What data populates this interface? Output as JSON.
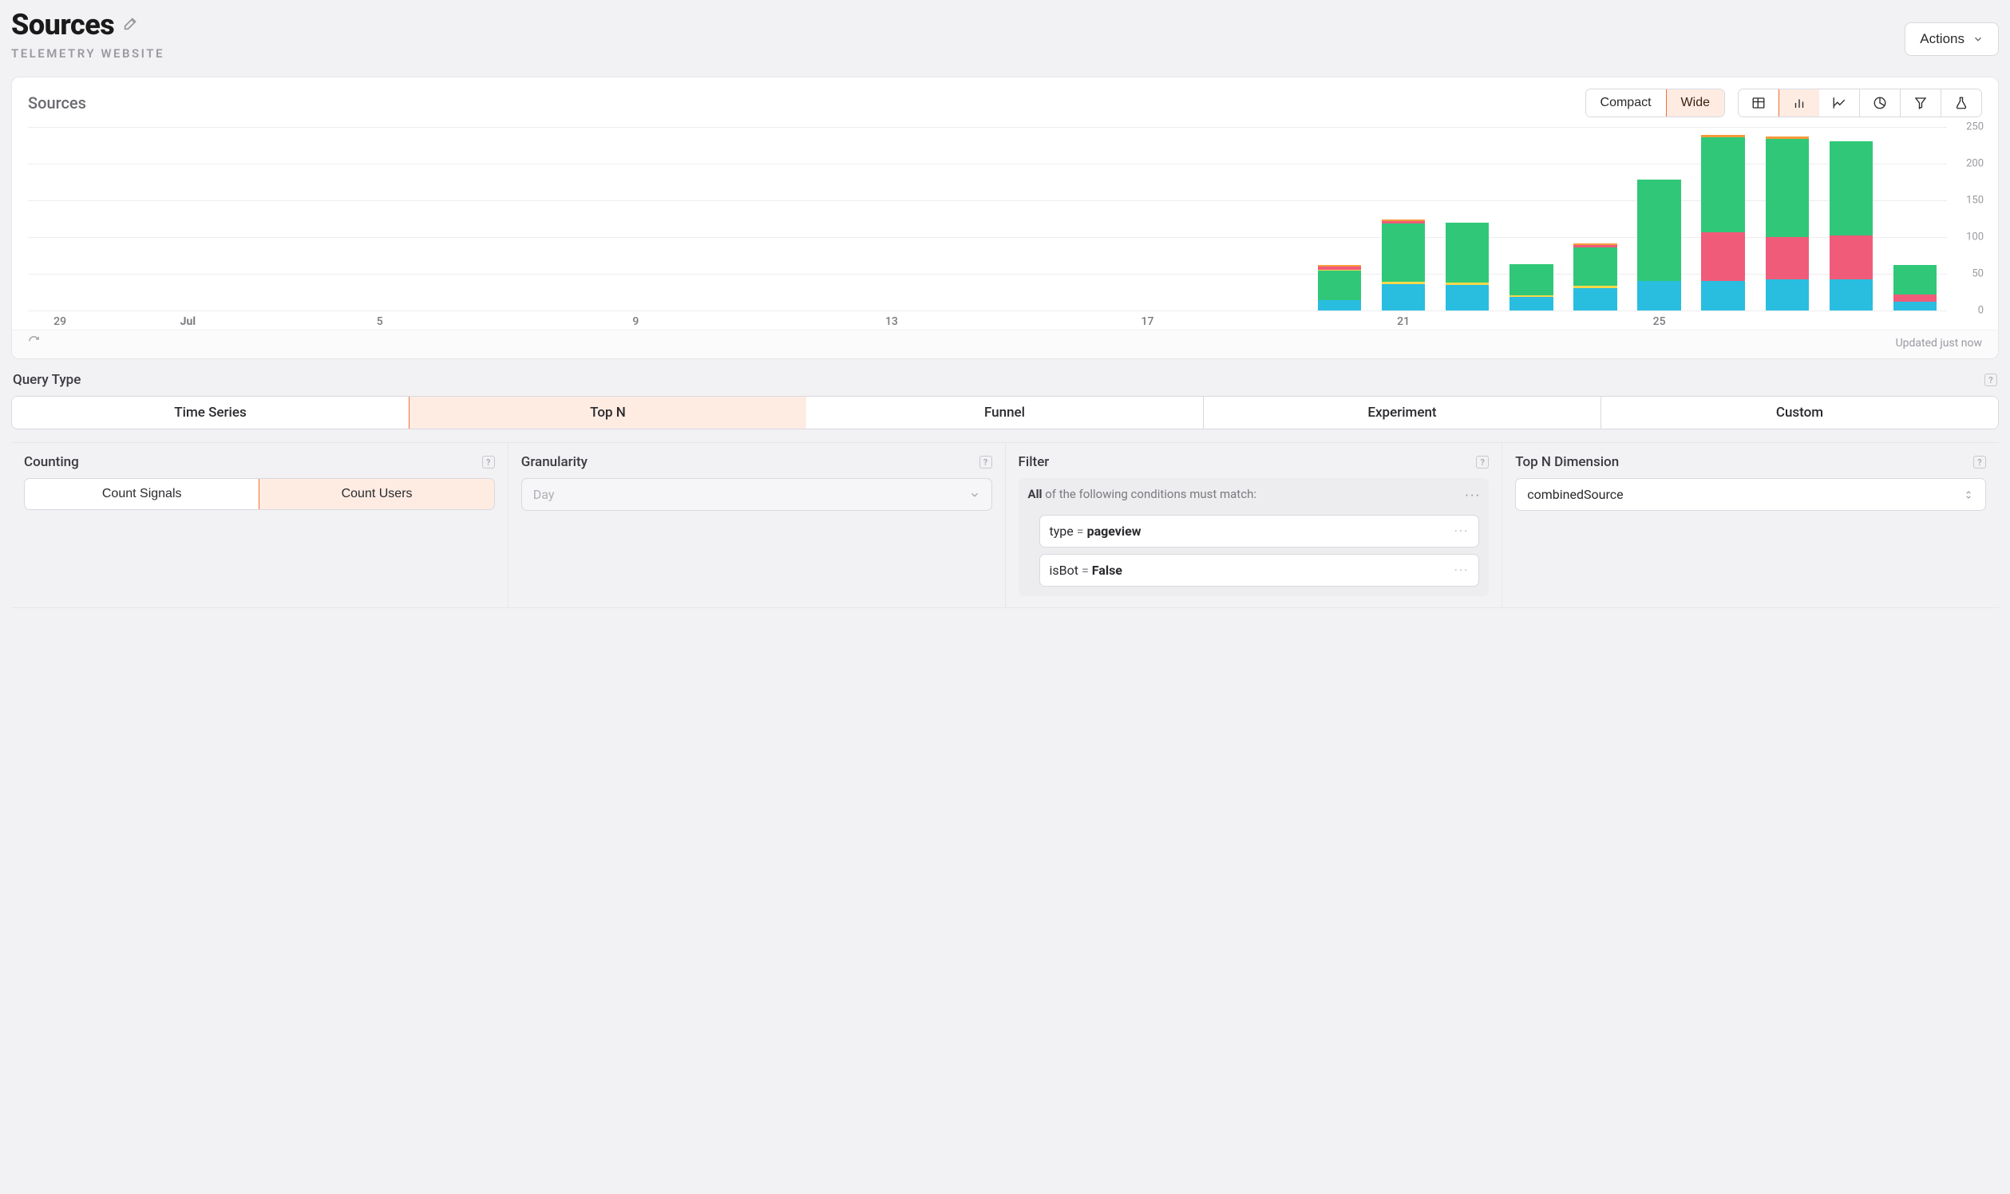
{
  "header": {
    "title": "Sources",
    "subtitle": "TELEMETRY WEBSITE",
    "actions_label": "Actions"
  },
  "chart_card": {
    "title": "Sources",
    "view_toggle": {
      "compact": "Compact",
      "wide": "Wide",
      "active": "wide"
    },
    "icon_tabs": [
      "table",
      "bar",
      "line",
      "pie",
      "funnel",
      "flask"
    ],
    "icon_tabs_active": "bar",
    "updated_text": "Updated just now"
  },
  "chart_data": {
    "type": "bar",
    "stacked": true,
    "ylabel": "",
    "xlabel": "",
    "ylim": [
      0,
      250
    ],
    "yticks": [
      0,
      50,
      100,
      150,
      200,
      250
    ],
    "categories": [
      "29",
      "",
      "Jul",
      "",
      "",
      "5",
      "",
      "",
      "",
      "9",
      "",
      "",
      "",
      "13",
      "",
      "",
      "",
      "17",
      "",
      "",
      "",
      "21",
      "",
      "",
      "",
      "25",
      "",
      "",
      ""
    ],
    "x_tick_labels": {
      "0": "29",
      "2": "Jul",
      "5": "5",
      "9": "9",
      "13": "13",
      "17": "17",
      "21": "21",
      "25": "25"
    },
    "series_colors": {
      "blue": "#29bde0",
      "green": "#30c878",
      "pink": "#f05b7a",
      "orange": "#f59b3a",
      "yellow": "#f8d84a"
    },
    "bars": [
      {
        "i": 0,
        "segments": []
      },
      {
        "i": 1,
        "segments": []
      },
      {
        "i": 2,
        "segments": []
      },
      {
        "i": 3,
        "segments": []
      },
      {
        "i": 4,
        "segments": []
      },
      {
        "i": 5,
        "segments": []
      },
      {
        "i": 6,
        "segments": []
      },
      {
        "i": 7,
        "segments": []
      },
      {
        "i": 8,
        "segments": []
      },
      {
        "i": 9,
        "segments": []
      },
      {
        "i": 10,
        "segments": []
      },
      {
        "i": 11,
        "segments": []
      },
      {
        "i": 12,
        "segments": []
      },
      {
        "i": 13,
        "segments": []
      },
      {
        "i": 14,
        "segments": []
      },
      {
        "i": 15,
        "segments": []
      },
      {
        "i": 16,
        "segments": []
      },
      {
        "i": 17,
        "segments": []
      },
      {
        "i": 18,
        "segments": []
      },
      {
        "i": 19,
        "segments": []
      },
      {
        "i": 20,
        "segments": [
          {
            "c": "blue",
            "v": 14
          },
          {
            "c": "green",
            "v": 40
          },
          {
            "c": "yellow",
            "v": 2
          },
          {
            "c": "pink",
            "v": 4
          },
          {
            "c": "orange",
            "v": 2
          }
        ]
      },
      {
        "i": 21,
        "segments": [
          {
            "c": "blue",
            "v": 36
          },
          {
            "c": "yellow",
            "v": 3
          },
          {
            "c": "green",
            "v": 80
          },
          {
            "c": "pink",
            "v": 3
          },
          {
            "c": "orange",
            "v": 2
          }
        ]
      },
      {
        "i": 22,
        "segments": [
          {
            "c": "blue",
            "v": 35
          },
          {
            "c": "yellow",
            "v": 3
          },
          {
            "c": "green",
            "v": 82
          }
        ]
      },
      {
        "i": 23,
        "segments": [
          {
            "c": "blue",
            "v": 18
          },
          {
            "c": "yellow",
            "v": 3
          },
          {
            "c": "green",
            "v": 42
          }
        ]
      },
      {
        "i": 24,
        "segments": [
          {
            "c": "blue",
            "v": 30
          },
          {
            "c": "yellow",
            "v": 4
          },
          {
            "c": "green",
            "v": 52
          },
          {
            "c": "pink",
            "v": 3
          },
          {
            "c": "orange",
            "v": 2
          }
        ]
      },
      {
        "i": 25,
        "segments": [
          {
            "c": "blue",
            "v": 40
          },
          {
            "c": "green",
            "v": 138
          }
        ]
      },
      {
        "i": 26,
        "segments": [
          {
            "c": "blue",
            "v": 40
          },
          {
            "c": "pink",
            "v": 66
          },
          {
            "c": "green",
            "v": 130
          },
          {
            "c": "orange",
            "v": 3
          }
        ]
      },
      {
        "i": 27,
        "segments": [
          {
            "c": "blue",
            "v": 42
          },
          {
            "c": "pink",
            "v": 58
          },
          {
            "c": "green",
            "v": 134
          },
          {
            "c": "orange",
            "v": 3
          }
        ]
      },
      {
        "i": 28,
        "segments": [
          {
            "c": "blue",
            "v": 42
          },
          {
            "c": "pink",
            "v": 60
          },
          {
            "c": "green",
            "v": 128
          }
        ]
      },
      {
        "i": 29,
        "segments": [
          {
            "c": "blue",
            "v": 12
          },
          {
            "c": "pink",
            "v": 10
          },
          {
            "c": "green",
            "v": 40
          }
        ]
      }
    ]
  },
  "query_type": {
    "label": "Query Type",
    "tabs": [
      "Time Series",
      "Top N",
      "Funnel",
      "Experiment",
      "Custom"
    ],
    "active": "Top N"
  },
  "counting": {
    "label": "Counting",
    "options": [
      "Count Signals",
      "Count Users"
    ],
    "active": "Count Users"
  },
  "granularity": {
    "label": "Granularity",
    "value": "Day",
    "disabled": true
  },
  "filter": {
    "label": "Filter",
    "prefix_bold": "All",
    "prefix_rest": " of the following conditions must match:",
    "items": [
      {
        "field": "type",
        "op": "=",
        "value": "pageview"
      },
      {
        "field": "isBot",
        "op": "=",
        "value": "False"
      }
    ]
  },
  "topn_dim": {
    "label": "Top N Dimension",
    "value": "combinedSource"
  }
}
